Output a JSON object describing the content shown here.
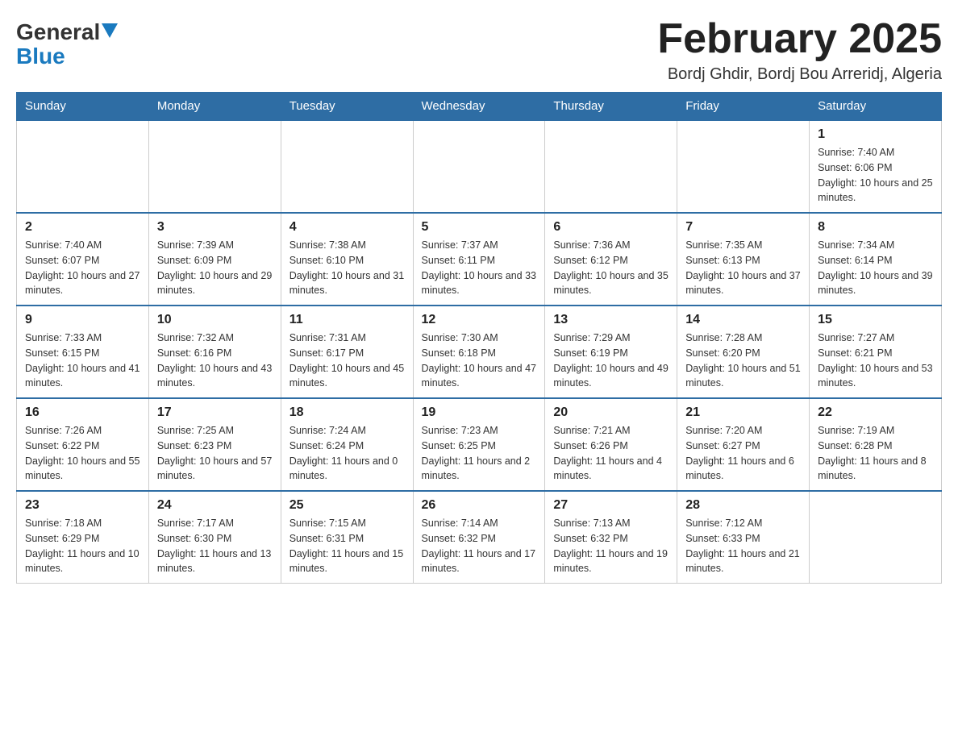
{
  "logo": {
    "general": "General",
    "blue": "Blue"
  },
  "header": {
    "month": "February 2025",
    "location": "Bordj Ghdir, Bordj Bou Arreridj, Algeria"
  },
  "days_of_week": [
    "Sunday",
    "Monday",
    "Tuesday",
    "Wednesday",
    "Thursday",
    "Friday",
    "Saturday"
  ],
  "weeks": [
    [
      {
        "day": "",
        "info": ""
      },
      {
        "day": "",
        "info": ""
      },
      {
        "day": "",
        "info": ""
      },
      {
        "day": "",
        "info": ""
      },
      {
        "day": "",
        "info": ""
      },
      {
        "day": "",
        "info": ""
      },
      {
        "day": "1",
        "info": "Sunrise: 7:40 AM\nSunset: 6:06 PM\nDaylight: 10 hours and 25 minutes."
      }
    ],
    [
      {
        "day": "2",
        "info": "Sunrise: 7:40 AM\nSunset: 6:07 PM\nDaylight: 10 hours and 27 minutes."
      },
      {
        "day": "3",
        "info": "Sunrise: 7:39 AM\nSunset: 6:09 PM\nDaylight: 10 hours and 29 minutes."
      },
      {
        "day": "4",
        "info": "Sunrise: 7:38 AM\nSunset: 6:10 PM\nDaylight: 10 hours and 31 minutes."
      },
      {
        "day": "5",
        "info": "Sunrise: 7:37 AM\nSunset: 6:11 PM\nDaylight: 10 hours and 33 minutes."
      },
      {
        "day": "6",
        "info": "Sunrise: 7:36 AM\nSunset: 6:12 PM\nDaylight: 10 hours and 35 minutes."
      },
      {
        "day": "7",
        "info": "Sunrise: 7:35 AM\nSunset: 6:13 PM\nDaylight: 10 hours and 37 minutes."
      },
      {
        "day": "8",
        "info": "Sunrise: 7:34 AM\nSunset: 6:14 PM\nDaylight: 10 hours and 39 minutes."
      }
    ],
    [
      {
        "day": "9",
        "info": "Sunrise: 7:33 AM\nSunset: 6:15 PM\nDaylight: 10 hours and 41 minutes."
      },
      {
        "day": "10",
        "info": "Sunrise: 7:32 AM\nSunset: 6:16 PM\nDaylight: 10 hours and 43 minutes."
      },
      {
        "day": "11",
        "info": "Sunrise: 7:31 AM\nSunset: 6:17 PM\nDaylight: 10 hours and 45 minutes."
      },
      {
        "day": "12",
        "info": "Sunrise: 7:30 AM\nSunset: 6:18 PM\nDaylight: 10 hours and 47 minutes."
      },
      {
        "day": "13",
        "info": "Sunrise: 7:29 AM\nSunset: 6:19 PM\nDaylight: 10 hours and 49 minutes."
      },
      {
        "day": "14",
        "info": "Sunrise: 7:28 AM\nSunset: 6:20 PM\nDaylight: 10 hours and 51 minutes."
      },
      {
        "day": "15",
        "info": "Sunrise: 7:27 AM\nSunset: 6:21 PM\nDaylight: 10 hours and 53 minutes."
      }
    ],
    [
      {
        "day": "16",
        "info": "Sunrise: 7:26 AM\nSunset: 6:22 PM\nDaylight: 10 hours and 55 minutes."
      },
      {
        "day": "17",
        "info": "Sunrise: 7:25 AM\nSunset: 6:23 PM\nDaylight: 10 hours and 57 minutes."
      },
      {
        "day": "18",
        "info": "Sunrise: 7:24 AM\nSunset: 6:24 PM\nDaylight: 11 hours and 0 minutes."
      },
      {
        "day": "19",
        "info": "Sunrise: 7:23 AM\nSunset: 6:25 PM\nDaylight: 11 hours and 2 minutes."
      },
      {
        "day": "20",
        "info": "Sunrise: 7:21 AM\nSunset: 6:26 PM\nDaylight: 11 hours and 4 minutes."
      },
      {
        "day": "21",
        "info": "Sunrise: 7:20 AM\nSunset: 6:27 PM\nDaylight: 11 hours and 6 minutes."
      },
      {
        "day": "22",
        "info": "Sunrise: 7:19 AM\nSunset: 6:28 PM\nDaylight: 11 hours and 8 minutes."
      }
    ],
    [
      {
        "day": "23",
        "info": "Sunrise: 7:18 AM\nSunset: 6:29 PM\nDaylight: 11 hours and 10 minutes."
      },
      {
        "day": "24",
        "info": "Sunrise: 7:17 AM\nSunset: 6:30 PM\nDaylight: 11 hours and 13 minutes."
      },
      {
        "day": "25",
        "info": "Sunrise: 7:15 AM\nSunset: 6:31 PM\nDaylight: 11 hours and 15 minutes."
      },
      {
        "day": "26",
        "info": "Sunrise: 7:14 AM\nSunset: 6:32 PM\nDaylight: 11 hours and 17 minutes."
      },
      {
        "day": "27",
        "info": "Sunrise: 7:13 AM\nSunset: 6:32 PM\nDaylight: 11 hours and 19 minutes."
      },
      {
        "day": "28",
        "info": "Sunrise: 7:12 AM\nSunset: 6:33 PM\nDaylight: 11 hours and 21 minutes."
      },
      {
        "day": "",
        "info": ""
      }
    ]
  ]
}
